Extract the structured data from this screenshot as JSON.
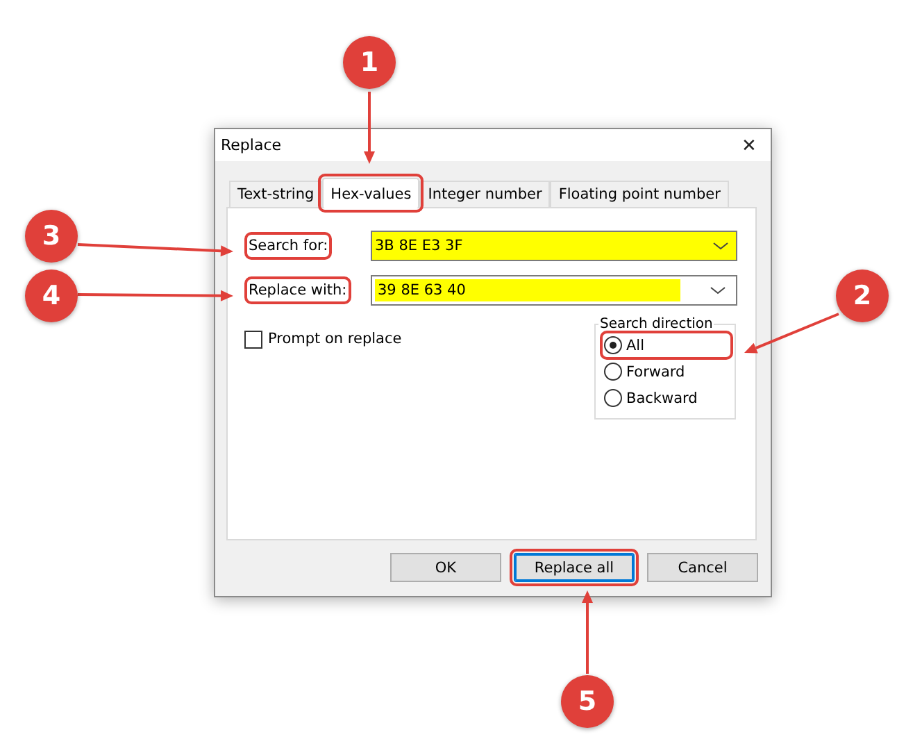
{
  "window": {
    "title": "Replace",
    "close": "✕"
  },
  "tabs": [
    {
      "label": "Text-string",
      "selected": false,
      "highlighted": false
    },
    {
      "label": "Hex-values",
      "selected": true,
      "highlighted": true
    },
    {
      "label": "Integer number",
      "selected": false,
      "highlighted": false
    },
    {
      "label": "Floating point number",
      "selected": false,
      "highlighted": false
    }
  ],
  "fields": [
    {
      "label": "Search for:",
      "value": "3B 8E E3 3F",
      "kind": "list",
      "highlighted": true
    },
    {
      "label": "Replace with:",
      "value": "39 8E 63 40",
      "kind": "edit",
      "highlighted": true
    }
  ],
  "prompt_checkbox": {
    "label": "Prompt on replace",
    "checked": false
  },
  "search_direction": {
    "title": "Search direction",
    "options": [
      {
        "label": "All",
        "selected": true,
        "highlighted": true
      },
      {
        "label": "Forward",
        "selected": false,
        "highlighted": false
      },
      {
        "label": "Backward",
        "selected": false,
        "highlighted": false
      }
    ]
  },
  "buttons": [
    {
      "label": "OK",
      "highlighted": false,
      "focused": false
    },
    {
      "label": "Replace all",
      "highlighted": true,
      "focused": true
    },
    {
      "label": "Cancel",
      "highlighted": false,
      "focused": false
    }
  ],
  "callouts": [
    {
      "number": "1"
    },
    {
      "number": "2"
    },
    {
      "number": "3"
    },
    {
      "number": "4"
    },
    {
      "number": "5"
    }
  ]
}
